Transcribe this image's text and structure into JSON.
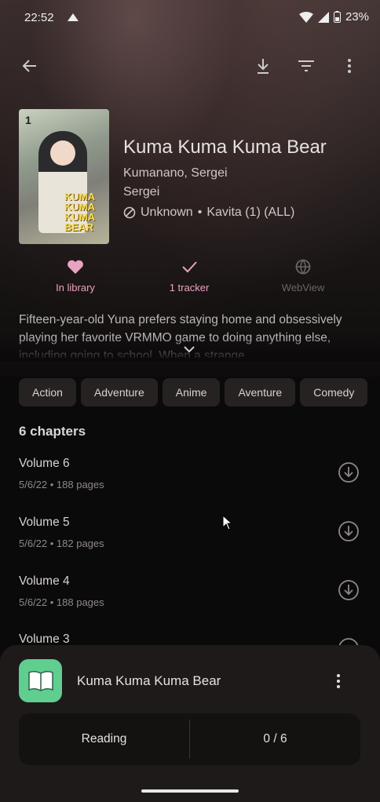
{
  "status_bar": {
    "time": "22:52",
    "battery": "23%"
  },
  "manga": {
    "title": "Kuma Kuma Kuma Bear",
    "author": "Kumanano, Sergei",
    "artist": "Sergei",
    "status": "Unknown",
    "source": "Kavita (1) (ALL)",
    "cover_number": "1",
    "cover_logo": "KUMA KUMA KUMA BEAR"
  },
  "actions": {
    "library": "In library",
    "tracker": "1 tracker",
    "webview": "WebView"
  },
  "description": "Fifteen-year-old Yuna prefers staying home and obsessively playing her favorite VRMMO game to doing anything else, including going to school. When a strange",
  "genres": [
    "Action",
    "Adventure",
    "Anime",
    "Aventure",
    "Comedy"
  ],
  "chapters_header": "6 chapters",
  "chapters": [
    {
      "title": "Volume 6",
      "meta": "5/6/22 • 188 pages"
    },
    {
      "title": "Volume 5",
      "meta": "5/6/22 • 182 pages"
    },
    {
      "title": "Volume 4",
      "meta": "5/6/22 • 188 pages"
    },
    {
      "title": "Volume 3",
      "meta": ""
    }
  ],
  "tracking_sheet": {
    "title": "Kuma Kuma Kuma Bear",
    "status": "Reading",
    "progress": "0 / 6"
  },
  "colors": {
    "accent": "#e7a3c0",
    "tracker_icon_bg": "#5fce8e"
  }
}
